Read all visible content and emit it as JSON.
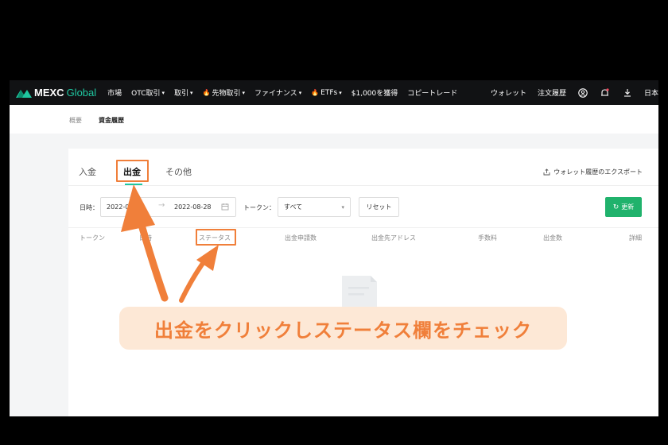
{
  "app": {
    "brand": "MEXC",
    "brand_suffix": "Global",
    "accent": "#1fc7a0",
    "annotation_color": "#f07f3a"
  },
  "topnav": {
    "items": [
      {
        "label": "市場"
      },
      {
        "label": "OTC取引",
        "dropdown": true
      },
      {
        "label": "取引",
        "dropdown": true
      },
      {
        "label": "先物取引",
        "dropdown": true,
        "hot": true
      },
      {
        "label": "ファイナンス",
        "dropdown": true
      },
      {
        "label": "ETFs",
        "dropdown": true,
        "hot": true
      },
      {
        "label": "$1,000を獲得"
      },
      {
        "label": "コピートレード"
      }
    ],
    "right": {
      "wallet": "ウォレット",
      "orders": "注文履歴",
      "lang": "日本"
    },
    "icons": [
      "user-icon",
      "bell-icon",
      "download-icon"
    ]
  },
  "subnav": {
    "overview": "概要",
    "history": "資金履歴"
  },
  "tabs": {
    "deposit": "入金",
    "withdraw": "出金",
    "other": "その他",
    "active": "withdraw"
  },
  "export_label": "ウォレット履歴のエクスポート",
  "filters": {
    "date_label": "日時：",
    "start_date": "2022-0",
    "end_date": "2022-08-28",
    "token_label": "トークン：",
    "token_value": "すべて",
    "reset": "リセット",
    "refresh": "更新"
  },
  "table": {
    "columns": [
      "トークン",
      "日時",
      "ステータス",
      "出金申請数",
      "出金先アドレス",
      "手数料",
      "出金数",
      "詳細"
    ]
  },
  "annotation": {
    "callout": "出金をクリックしステータス欄をチェック"
  }
}
